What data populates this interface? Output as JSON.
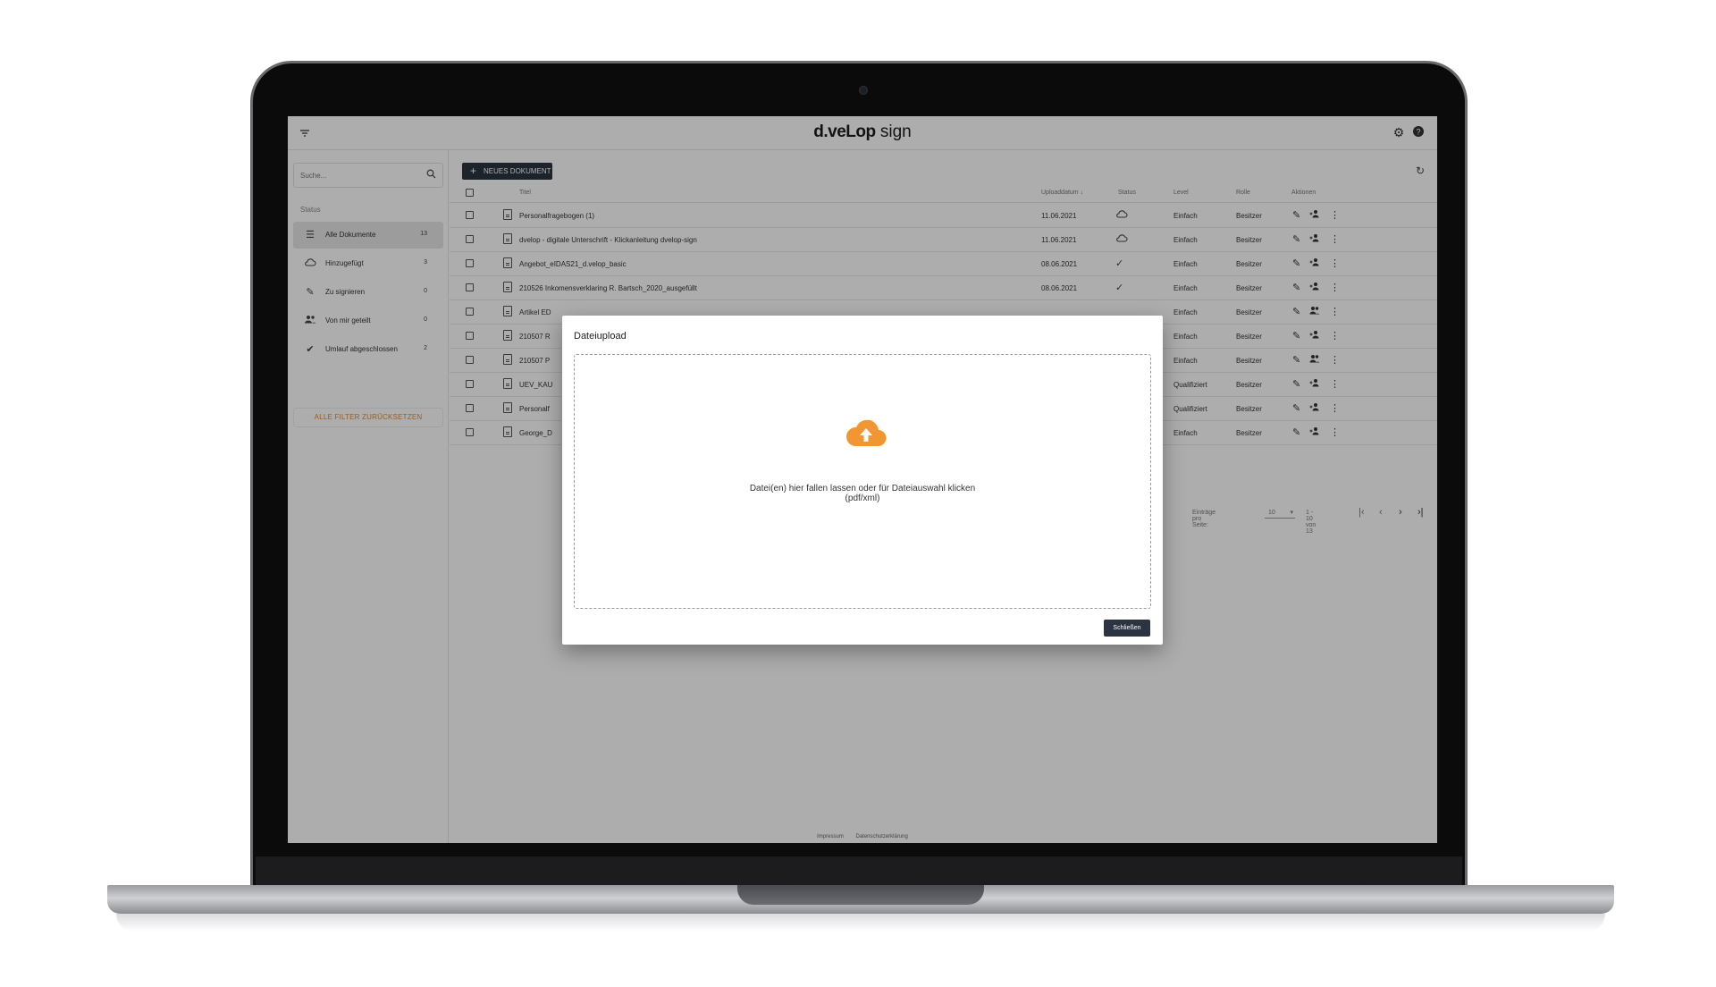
{
  "app": {
    "brand_bold": "d.veLop",
    "brand_light": " sign"
  },
  "sidebar": {
    "search_placeholder": "Suche...",
    "status_label": "Status",
    "items": [
      {
        "label": "Alle Dokumente",
        "count": "13"
      },
      {
        "label": "Hinzugefügt",
        "count": "3"
      },
      {
        "label": "Zu signieren",
        "count": "0"
      },
      {
        "label": "Von mir geteilt",
        "count": "0"
      },
      {
        "label": "Umlauf abgeschlossen",
        "count": "2"
      }
    ],
    "reset_label": "ALLE FILTER ZURÜCKSETZEN"
  },
  "main": {
    "new_doc_label": "NEUES DOKUMENT",
    "columns": {
      "title": "Titel",
      "upload": "Uploaddatum",
      "status": "Status",
      "level": "Level",
      "role": "Rolle",
      "actions": "Aktionen"
    },
    "rows": [
      {
        "title": "Personalfragebogen (1)",
        "date": "11.06.2021",
        "status": "cloud",
        "level": "Einfach",
        "role": "Besitzer"
      },
      {
        "title": "dvelop - digitale Unterschrift - Klickanleitung dvelop-sign",
        "date": "11.06.2021",
        "status": "cloud",
        "level": "Einfach",
        "role": "Besitzer"
      },
      {
        "title": "Angebot_eIDAS21_d.velop_basic",
        "date": "08.06.2021",
        "status": "check",
        "level": "Einfach",
        "role": "Besitzer"
      },
      {
        "title": "210526 Inkomensverklaring R. Bartsch_2020_ausgefüllt",
        "date": "08.06.2021",
        "status": "check",
        "level": "Einfach",
        "role": "Besitzer"
      },
      {
        "title": "Artikel ED",
        "date": "",
        "status": "",
        "level": "Einfach",
        "role": "Besitzer"
      },
      {
        "title": "210507 R",
        "date": "",
        "status": "",
        "level": "Einfach",
        "role": "Besitzer"
      },
      {
        "title": "210507 P",
        "date": "",
        "status": "",
        "level": "Einfach",
        "role": "Besitzer"
      },
      {
        "title": "UEV_KAU",
        "date": "",
        "status": "",
        "level": "Qualifiziert",
        "role": "Besitzer"
      },
      {
        "title": "Personalf",
        "date": "",
        "status": "",
        "level": "Qualifiziert",
        "role": "Besitzer"
      },
      {
        "title": "George_D",
        "date": "",
        "status": "",
        "level": "Einfach",
        "role": "Besitzer"
      }
    ],
    "pager": {
      "per_page_label": "Einträge pro Seite:",
      "per_page_value": "10",
      "range": "1 - 10 von 13"
    }
  },
  "footer": {
    "impressum": "Impressum",
    "privacy": "Datenschutzerklärung"
  },
  "dialog": {
    "title": "Dateiupload",
    "drop_line1": "Datei(en) hier fallen lassen oder für Dateiauswahl klicken",
    "drop_line2": "(pdf/xml)",
    "close_label": "Schließen",
    "accent": "#f29632"
  }
}
